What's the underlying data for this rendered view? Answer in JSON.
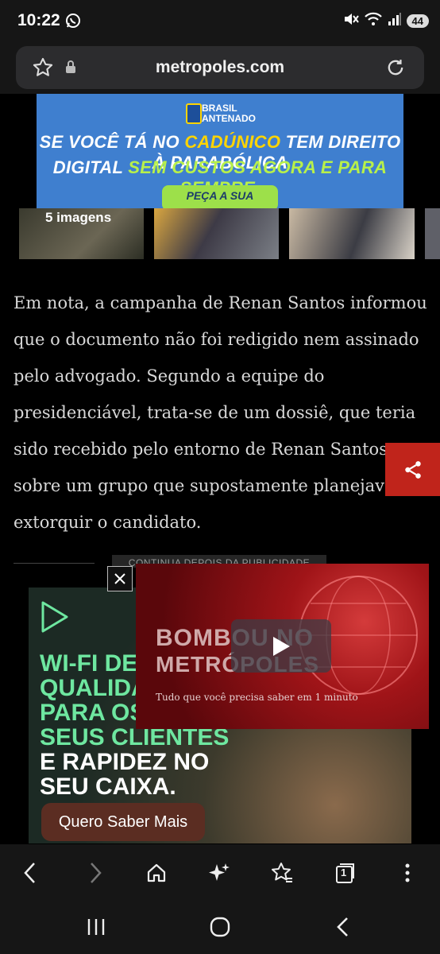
{
  "status_bar": {
    "time": "10:22",
    "battery": "44"
  },
  "browser": {
    "url": "metropoles.com",
    "tab_count": "1"
  },
  "top_ad": {
    "brand": "BRASIL ANTENADO",
    "line1_prefix": "SE VOCÊ TÁ NO ",
    "line1_highlight": "CADÚNICO",
    "line1_suffix": " TEM DIREITO À PARABÓLICA",
    "line2_prefix": "DIGITAL ",
    "line2_highlight": "SEM CUSTOS AGORA E PARA SEMPRE.",
    "cta": "PEÇA A SUA"
  },
  "gallery": {
    "count_label": "5 imagens"
  },
  "article": {
    "paragraph": "Em nota, a campanha de Renan Santos informou que o documento não foi redigido nem assinado pelo advogado. Segundo a equipe do presidenciável, trata-se de um dossiê, que teria sido recebido pelo entorno de Renan Santos, sobre um grupo que supostamente planejava extorquir o candidato."
  },
  "ad_separator": "CONTINUA DEPOIS DA PUBLICIDADE",
  "bottom_ad": {
    "green_lines": [
      "WI-FI DE",
      "QUALIDADE",
      "PARA OS",
      "SEUS CLIENTES"
    ],
    "white_lines": [
      "E RAPIDEZ NO",
      "SEU CAIXA."
    ],
    "cta": "Quero Saber Mais"
  },
  "video": {
    "title_line1": "BOMBOU NO",
    "title_line2": "METRÓPOLES",
    "subtitle": "Tudo que você precisa saber em 1 minuto"
  },
  "colors": {
    "share": "#c0241b",
    "ad_blue": "#3f7fcf",
    "ad_green": "#9de04a",
    "video_red": "#7a0c10"
  }
}
